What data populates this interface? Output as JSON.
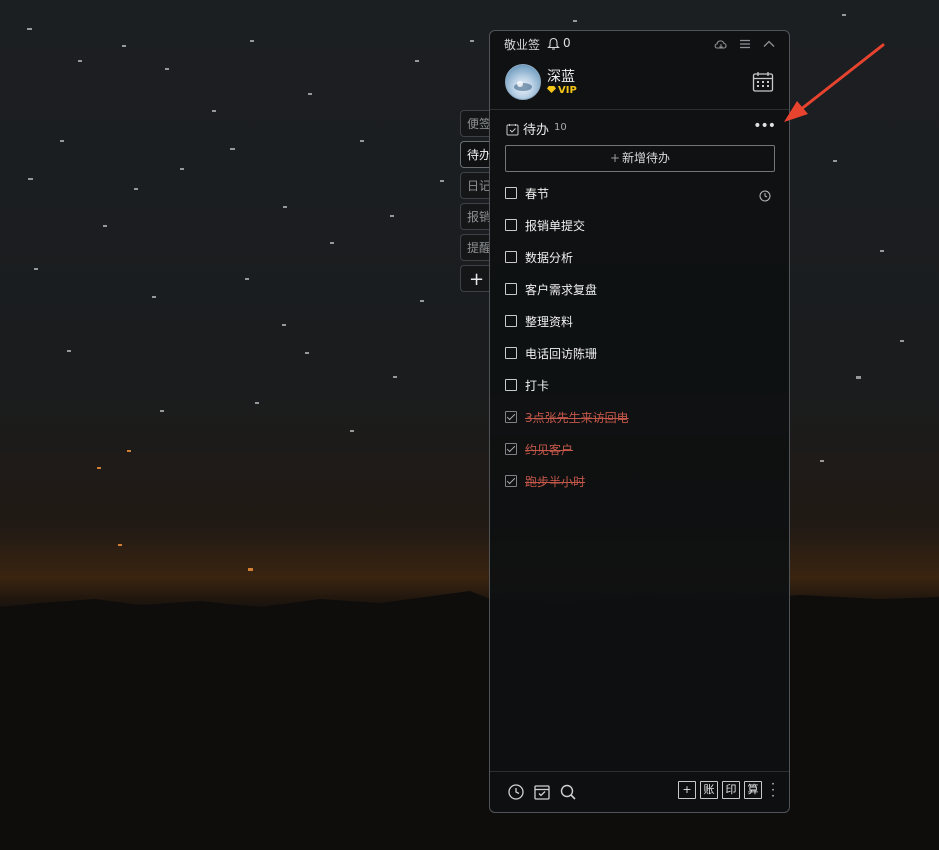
{
  "app": {
    "title": "敬业签",
    "notification_count": "0"
  },
  "side_tabs": [
    {
      "label": "便签"
    },
    {
      "label": "待办"
    },
    {
      "label": "日记"
    },
    {
      "label": "报销"
    },
    {
      "label": "提醒"
    },
    {
      "label": "+"
    }
  ],
  "profile": {
    "name": "深蓝",
    "badge": "VIP"
  },
  "todo": {
    "title": "待办",
    "count": "10",
    "add_label": "新增待办",
    "add_plus": "+",
    "more": "•••",
    "items": [
      {
        "text": "春节",
        "done": false,
        "has_clock": true
      },
      {
        "text": "报销单提交",
        "done": false
      },
      {
        "text": "数据分析",
        "done": false
      },
      {
        "text": "客户需求复盘",
        "done": false
      },
      {
        "text": "整理资料",
        "done": false
      },
      {
        "text": "电话回访陈珊",
        "done": false
      },
      {
        "text": "打卡",
        "done": false
      },
      {
        "text": "3点张先生来访回电",
        "done": true
      },
      {
        "text": "约见客户",
        "done": true
      },
      {
        "text": "跑步半小时",
        "done": true
      }
    ]
  },
  "bottom": {
    "b1": "+",
    "b2": "账",
    "b3": "印",
    "b4": "算"
  },
  "colors": {
    "accent_arrow": "#e8432f",
    "done_text": "#c4574a",
    "vip": "#f5c518"
  }
}
